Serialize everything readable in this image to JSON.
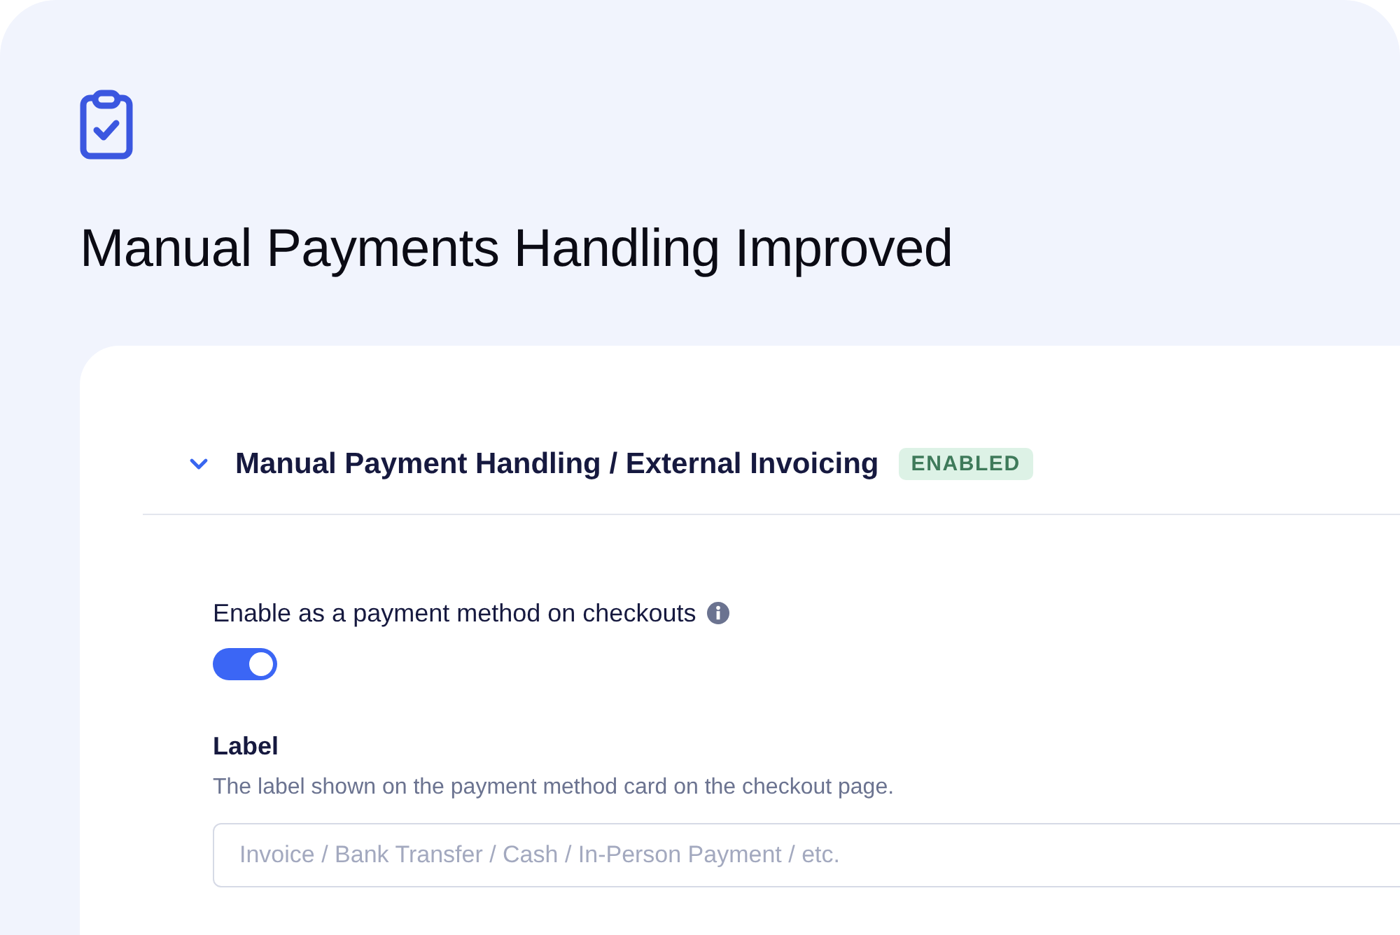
{
  "page": {
    "title": "Manual Payments Handling Improved"
  },
  "section": {
    "title": "Manual Payment Handling / External Invoicing",
    "expanded": true,
    "badge": "ENABLED"
  },
  "toggle": {
    "label": "Enable as a payment method on checkouts",
    "on": true
  },
  "field": {
    "label": "Label",
    "description": "The label shown on the payment method card on the checkout page.",
    "placeholder": "Invoice / Bank Transfer / Cash / In-Person Payment / etc."
  }
}
